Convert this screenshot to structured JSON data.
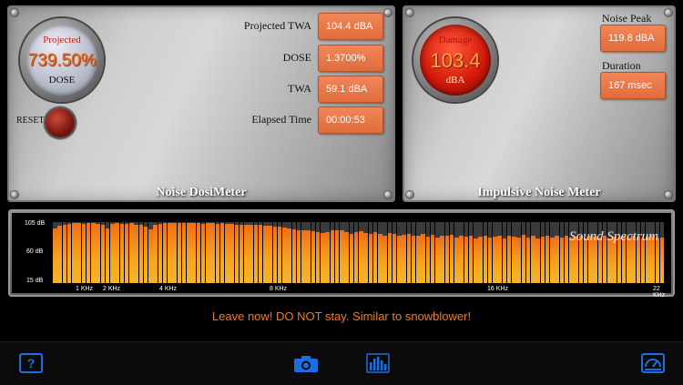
{
  "dosimeter": {
    "title": "Noise DosiMeter",
    "gauge_top": "Projected",
    "gauge_value": "739.50%",
    "gauge_bottom": "DOSE",
    "reset_label": "RESET",
    "rows": [
      {
        "label": "Projected TWA",
        "value": "104.4 dBA"
      },
      {
        "label": "DOSE",
        "value": "1.3700%"
      },
      {
        "label": "TWA",
        "value": "59.1 dBA"
      },
      {
        "label": "Elapsed Time",
        "value": "00:00:53"
      }
    ]
  },
  "impulsive": {
    "title": "Impulsive Noise Meter",
    "gauge_top": "Damage",
    "gauge_value": "103.4",
    "gauge_bottom": "dBA",
    "noise_peak_label": "Noise Peak",
    "noise_peak_value": "119.8 dBA",
    "duration_label": "Duration",
    "duration_value": "167 msec"
  },
  "spectrum": {
    "brand": "Sound Spectrum",
    "y_labels": [
      "105 dB",
      "60 dB",
      "15 dB"
    ],
    "x_labels": [
      "1 KHz",
      "2 KHz",
      "4 KHz",
      "8 KHz",
      "16 KHz",
      "22 KHz"
    ],
    "levels": [
      0.9,
      0.94,
      0.96,
      0.97,
      0.98,
      0.98,
      0.97,
      0.98,
      0.98,
      0.97,
      0.96,
      0.9,
      0.97,
      0.98,
      0.97,
      0.97,
      0.98,
      0.96,
      0.95,
      0.92,
      0.88,
      0.95,
      0.97,
      0.98,
      0.99,
      0.99,
      0.98,
      0.99,
      0.99,
      0.98,
      0.98,
      0.97,
      0.98,
      0.98,
      0.97,
      0.98,
      0.97,
      0.97,
      0.96,
      0.95,
      0.96,
      0.96,
      0.95,
      0.95,
      0.94,
      0.94,
      0.93,
      0.92,
      0.91,
      0.9,
      0.88,
      0.86,
      0.87,
      0.86,
      0.85,
      0.84,
      0.82,
      0.83,
      0.86,
      0.87,
      0.86,
      0.83,
      0.8,
      0.84,
      0.85,
      0.82,
      0.81,
      0.83,
      0.8,
      0.78,
      0.82,
      0.8,
      0.77,
      0.79,
      0.81,
      0.77,
      0.78,
      0.8,
      0.76,
      0.79,
      0.75,
      0.78,
      0.77,
      0.79,
      0.74,
      0.77,
      0.76,
      0.78,
      0.73,
      0.76,
      0.78,
      0.74,
      0.76,
      0.77,
      0.73,
      0.78,
      0.76,
      0.74,
      0.79,
      0.75,
      0.77,
      0.73,
      0.76,
      0.78,
      0.74,
      0.77,
      0.75,
      0.78,
      0.74,
      0.76,
      0.77,
      0.73,
      0.78,
      0.76,
      0.75,
      0.77,
      0.73,
      0.76,
      0.75,
      0.77,
      0.74,
      0.78,
      0.76,
      0.73,
      0.76,
      0.77,
      0.75,
      0.74
    ]
  },
  "warning_text": "Leave now! DO NOT stay. Similar to snowblower!",
  "toolbar": {
    "help_icon": "question-mark-icon",
    "camera_icon": "camera-icon",
    "spectrum_icon": "bar-chart-icon",
    "meter_icon": "meter-icon"
  },
  "colors": {
    "accent_orange": "#f07b24",
    "value_box": "#e8774a",
    "toolbar_blue": "#1d6fe0"
  }
}
